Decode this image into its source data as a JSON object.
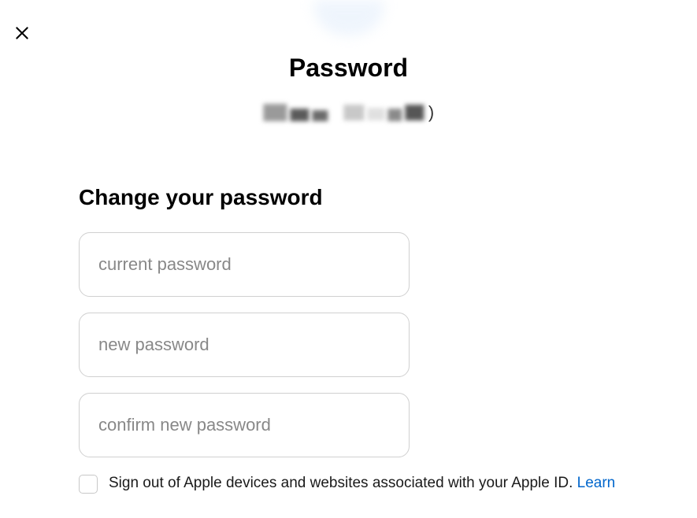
{
  "header": {
    "title": "Password"
  },
  "form": {
    "heading": "Change your password",
    "fields": {
      "current_password_placeholder": "current password",
      "new_password_placeholder": "new password",
      "confirm_password_placeholder": "confirm new password"
    },
    "signout": {
      "label_text": "Sign out of Apple devices and websites associated with your Apple ID. ",
      "learn_text": "Learn"
    }
  }
}
